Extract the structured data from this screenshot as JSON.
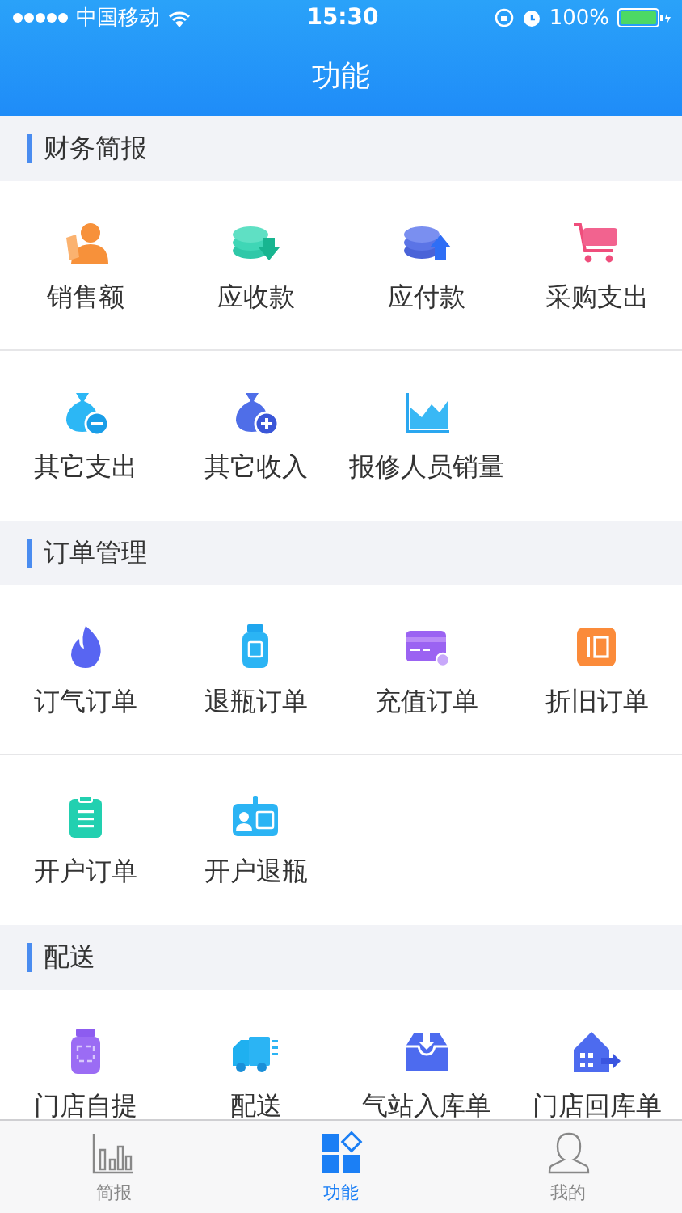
{
  "status_bar": {
    "carrier": "中国移动",
    "time": "15:30",
    "battery": "100%"
  },
  "nav_bar": {
    "title": "功能"
  },
  "sections": [
    {
      "title": "财务简报",
      "items": [
        {
          "label": "销售额",
          "kind": "person"
        },
        {
          "label": "应收款",
          "kind": "coins-in"
        },
        {
          "label": "应付款",
          "kind": "coins-out"
        },
        {
          "label": "采购支出",
          "kind": "cart"
        },
        {
          "label": "其它支出",
          "kind": "bag-minus"
        },
        {
          "label": "其它收入",
          "kind": "bag-plus"
        },
        {
          "label": "报修人员销量",
          "kind": "area"
        }
      ]
    },
    {
      "title": "订单管理",
      "items": [
        {
          "label": "订气订单",
          "kind": "flame"
        },
        {
          "label": "退瓶订单",
          "kind": "cylinder"
        },
        {
          "label": "充值订单",
          "kind": "card"
        },
        {
          "label": "折旧订单",
          "kind": "square"
        },
        {
          "label": "开户订单",
          "kind": "clipboard"
        },
        {
          "label": "开户退瓶",
          "kind": "idcard"
        }
      ]
    },
    {
      "title": "配送",
      "items": [
        {
          "label": "门店自提",
          "kind": "tank"
        },
        {
          "label": "配送",
          "kind": "truck"
        },
        {
          "label": "气站入库单",
          "kind": "inbox"
        },
        {
          "label": "门店回库单",
          "kind": "building"
        }
      ]
    }
  ],
  "tab_bar": [
    {
      "label": "简报",
      "kind": "chart",
      "selected": false
    },
    {
      "label": "功能",
      "kind": "grid",
      "selected": true
    },
    {
      "label": "我的",
      "kind": "user",
      "selected": false
    }
  ]
}
